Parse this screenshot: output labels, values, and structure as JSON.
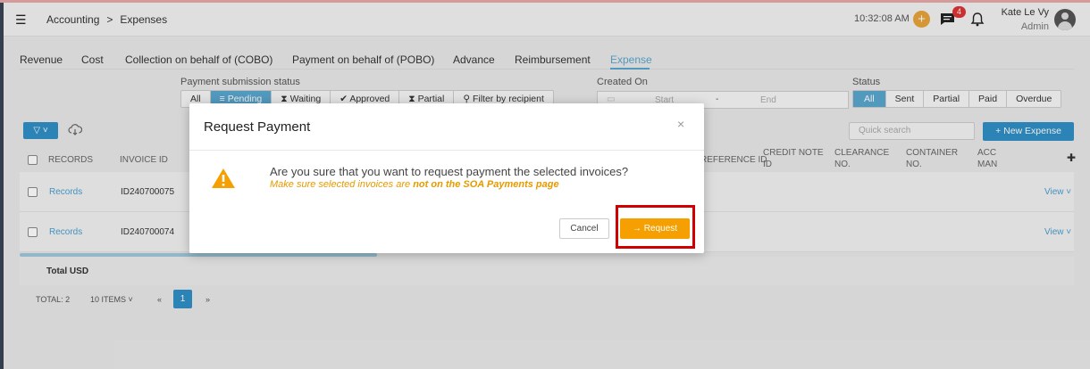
{
  "header": {
    "breadcrumb": [
      "Accounting",
      ">",
      "Expenses"
    ],
    "time": "10:32:08 AM",
    "notification_count": "4",
    "user_name": "Kate Le Vy",
    "user_role": "Admin"
  },
  "tabs": [
    "Revenue",
    "Cost",
    "Collection on behalf of (COBO)",
    "Payment on behalf of (POBO)",
    "Advance",
    "Reimbursement",
    "Expense"
  ],
  "active_tab": "Expense",
  "filters": {
    "payment_label": "Payment submission status",
    "payment_options": [
      "All",
      "Pending",
      "Waiting",
      "Approved",
      "Partial",
      "Filter by recipient"
    ],
    "payment_selected": "Pending",
    "created_label": "Created On",
    "start_placeholder": "Start",
    "date_sep": "-",
    "end_placeholder": "End",
    "status_label": "Status",
    "status_options": [
      "All",
      "Sent",
      "Partial",
      "Paid",
      "Overdue"
    ],
    "status_selected": "All"
  },
  "toolbar": {
    "search_placeholder": "Quick search",
    "new_button": "+ New Expense"
  },
  "table": {
    "headers": [
      "RECORDS",
      "INVOICE ID",
      "REFERENCE ID",
      "CREDIT NOTE ID",
      "CLEARANCE NO.",
      "CONTAINER NO.",
      "ACC MAN"
    ],
    "rows": [
      {
        "records": "Records",
        "invoice_id": "ID240700075",
        "action": "View"
      },
      {
        "records": "Records",
        "invoice_id": "ID240700074",
        "action": "View"
      }
    ],
    "total_label": "Total USD"
  },
  "pagination": {
    "total": "TOTAL: 2",
    "per_page": "10 ITEMS",
    "prev": "«",
    "page": "1",
    "next": "»"
  },
  "modal": {
    "title": "Request Payment",
    "close": "×",
    "question": "Are you sure that you want to request payment the selected invoices?",
    "note_prefix": "Make sure selected invoices are ",
    "note_bold": "not on the SOA Payments page",
    "cancel": "Cancel",
    "request": "→ Request"
  },
  "colors": {
    "accent": "#2f8fc6",
    "warning": "#f5a000",
    "highlight": "#d10000"
  }
}
